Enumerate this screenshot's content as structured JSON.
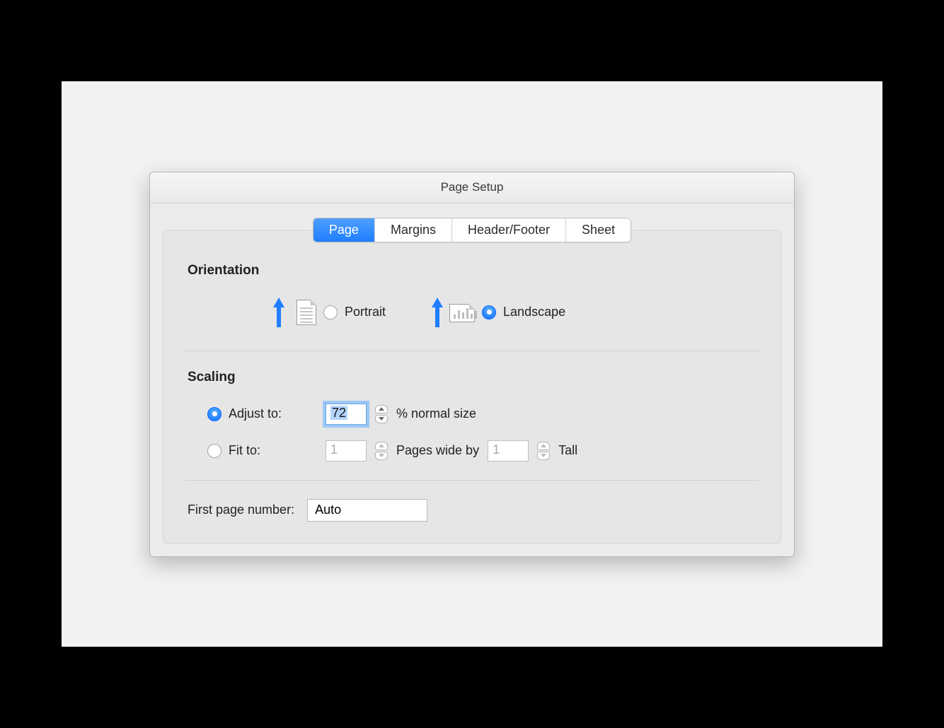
{
  "window": {
    "title": "Page Setup"
  },
  "tabs": {
    "items": [
      "Page",
      "Margins",
      "Header/Footer",
      "Sheet"
    ],
    "selected": 0
  },
  "orientation": {
    "heading": "Orientation",
    "portrait_label": "Portrait",
    "landscape_label": "Landscape",
    "selected": "landscape"
  },
  "scaling": {
    "heading": "Scaling",
    "adjust_label": "Adjust to:",
    "adjust_value": "72",
    "adjust_suffix": "% normal size",
    "fit_label": "Fit to:",
    "fit_wide_value": "1",
    "fit_mid_text": "Pages wide by",
    "fit_tall_value": "1",
    "fit_tall_label": "Tall",
    "selected": "adjust"
  },
  "first_page": {
    "label": "First page number:",
    "value": "Auto"
  }
}
